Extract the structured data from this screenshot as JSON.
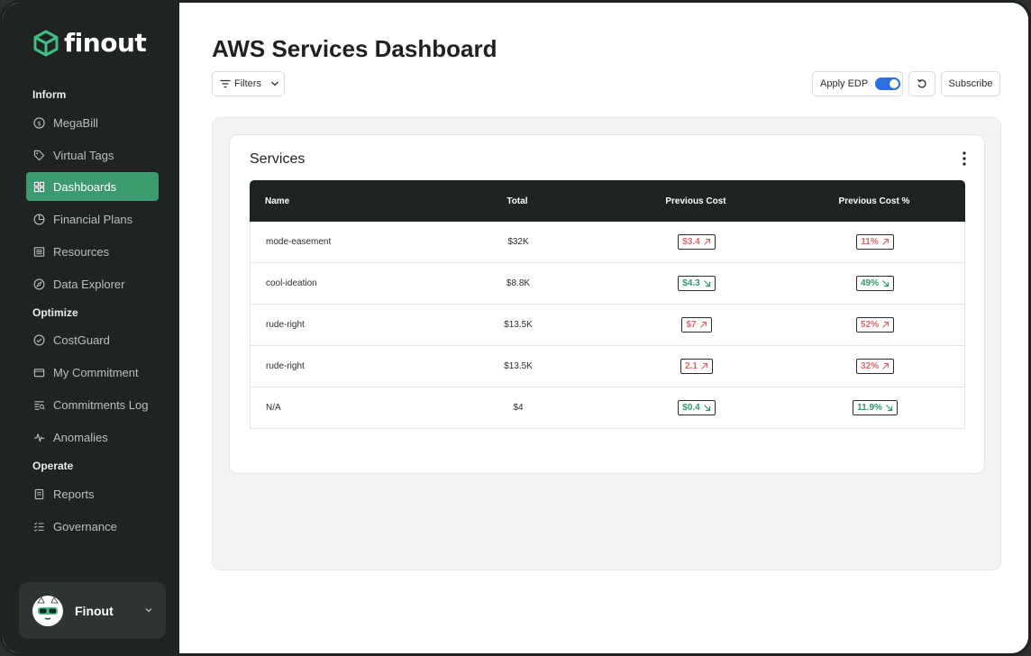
{
  "brand": {
    "name": "finout"
  },
  "sidebar": {
    "sections": [
      {
        "title": "Inform",
        "items": [
          {
            "label": "MegaBill",
            "icon": "dollar-circle-icon"
          },
          {
            "label": "Virtual Tags",
            "icon": "tag-icon"
          },
          {
            "label": "Dashboards",
            "icon": "grid-icon",
            "active": true
          },
          {
            "label": "Financial Plans",
            "icon": "pie-icon"
          },
          {
            "label": "Resources",
            "icon": "list-box-icon"
          },
          {
            "label": "Data Explorer",
            "icon": "compass-icon"
          }
        ]
      },
      {
        "title": "Optimize",
        "items": [
          {
            "label": "CostGuard",
            "icon": "check-circle-icon"
          },
          {
            "label": "My Commitment",
            "icon": "wallet-icon"
          },
          {
            "label": "Commitments Log",
            "icon": "log-icon"
          },
          {
            "label": "Anomalies",
            "icon": "pulse-icon"
          }
        ]
      },
      {
        "title": "Operate",
        "items": [
          {
            "label": "Reports",
            "icon": "report-icon"
          },
          {
            "label": "Governance",
            "icon": "checklist-icon"
          }
        ]
      }
    ],
    "user": {
      "name": "Finout"
    }
  },
  "header": {
    "title": "AWS Services Dashboard",
    "filters_label": "Filters",
    "apply_edp_label": "Apply EDP",
    "apply_edp_on": true,
    "subscribe_label": "Subscribe"
  },
  "widget": {
    "title": "Services",
    "columns": [
      "Name",
      "Total",
      "Previous Cost",
      "Previous Cost %"
    ],
    "rows": [
      {
        "name": "mode-easement",
        "total": "$32K",
        "prev": "$3.4",
        "prev_pct": "11%",
        "trend": "up"
      },
      {
        "name": "cool-ideation",
        "total": "$8.8K",
        "prev": "$4.3",
        "prev_pct": "49%",
        "trend": "down"
      },
      {
        "name": "rude-right",
        "total": "$13.5K",
        "prev": "$7",
        "prev_pct": "52%",
        "trend": "up"
      },
      {
        "name": "rude-right",
        "total": "$13.5K",
        "prev": "2.1",
        "prev_pct": "32%",
        "trend": "up"
      },
      {
        "name": "N/A",
        "total": "$4",
        "prev": "$0.4",
        "prev_pct": "11.9%",
        "trend": "down"
      }
    ]
  },
  "colors": {
    "sidebar_bg": "#1f2422",
    "active": "#3b9a6e",
    "up": "#e06868",
    "down": "#2f9a66",
    "toggle": "#2d6fe0"
  }
}
